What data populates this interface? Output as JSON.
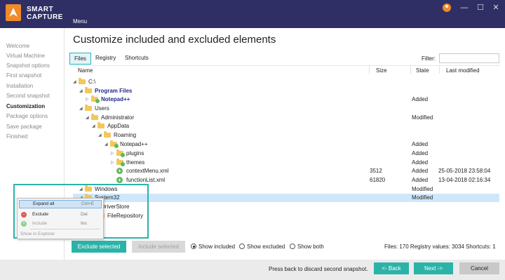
{
  "app": {
    "logo_line1": "SMART",
    "logo_line2": "CAPTURE",
    "menu": "Menu"
  },
  "window_controls": [
    "⚙",
    "—",
    "☐",
    "✕"
  ],
  "sidebar": {
    "items": [
      {
        "label": "Welcome",
        "active": false
      },
      {
        "label": "Virtual Machine",
        "active": false
      },
      {
        "label": "Snapshot options",
        "active": false
      },
      {
        "label": "First snapshot",
        "active": false
      },
      {
        "label": "Installation",
        "active": false
      },
      {
        "label": "Second snapshot",
        "active": false
      },
      {
        "label": "Customization",
        "active": true
      },
      {
        "label": "Package options",
        "active": false
      },
      {
        "label": "Save package",
        "active": false
      },
      {
        "label": "Finished",
        "active": false
      }
    ]
  },
  "main": {
    "title": "Customize included and excluded elements",
    "tabs": [
      {
        "label": "Files",
        "active": true
      },
      {
        "label": "Registry",
        "active": false
      },
      {
        "label": "Shortcuts",
        "active": false
      }
    ],
    "filter_label": "Filter:",
    "filter_value": "",
    "columns": {
      "name": "Name",
      "size": "Size",
      "state": "State",
      "modified": "Last modified"
    }
  },
  "tree": [
    {
      "name": "C:\\",
      "size": "",
      "state": "",
      "modified": "",
      "arrow": "◢",
      "icon": "folder",
      "highlight": false,
      "selected": false
    },
    {
      "name": "Program Files",
      "size": "",
      "state": "",
      "modified": "",
      "arrow": "◢",
      "icon": "folder",
      "highlight": true,
      "selected": false
    },
    {
      "name": "Notepad++",
      "size": "",
      "state": "Added",
      "modified": "",
      "arrow": "▷",
      "icon": "folder-plus",
      "highlight": true,
      "selected": false
    },
    {
      "name": "Users",
      "size": "",
      "state": "",
      "modified": "",
      "arrow": "◢",
      "icon": "folder",
      "highlight": false,
      "selected": false
    },
    {
      "name": "Administrator",
      "size": "",
      "state": "Modified",
      "modified": "",
      "arrow": "◢",
      "icon": "folder",
      "highlight": false,
      "selected": false
    },
    {
      "name": "AppData",
      "size": "",
      "state": "",
      "modified": "",
      "arrow": "◢",
      "icon": "folder",
      "highlight": false,
      "selected": false
    },
    {
      "name": "Roaming",
      "size": "",
      "state": "",
      "modified": "",
      "arrow": "◢",
      "icon": "folder",
      "highlight": false,
      "selected": false
    },
    {
      "name": "Notepad++",
      "size": "",
      "state": "Added",
      "modified": "",
      "arrow": "◢",
      "icon": "folder-plus",
      "highlight": false,
      "selected": false
    },
    {
      "name": "plugins",
      "size": "",
      "state": "Added",
      "modified": "",
      "arrow": "▷",
      "icon": "folder-plus",
      "highlight": false,
      "selected": false
    },
    {
      "name": "themes",
      "size": "",
      "state": "Added",
      "modified": "",
      "arrow": "▷",
      "icon": "folder-plus",
      "highlight": false,
      "selected": false
    },
    {
      "name": "contextMenu.xml",
      "size": "3512",
      "state": "Added",
      "modified": "25-05-2018 23:58:04",
      "arrow": "",
      "icon": "file-plus",
      "highlight": false,
      "selected": false
    },
    {
      "name": "functionList.xml",
      "size": "61820",
      "state": "Added",
      "modified": "13-04-2018 02:16:34",
      "arrow": "",
      "icon": "file-plus",
      "highlight": false,
      "selected": false
    },
    {
      "name": "Windows",
      "size": "",
      "state": "Modified",
      "modified": "",
      "arrow": "◢",
      "icon": "folder",
      "highlight": false,
      "selected": false
    },
    {
      "name": "System32",
      "size": "",
      "state": "Modified",
      "modified": "",
      "arrow": "◢",
      "icon": "folder",
      "highlight": false,
      "selected": true
    },
    {
      "name": "DriverStore",
      "size": "",
      "state": "",
      "modified": "",
      "arrow": "",
      "icon": "none",
      "highlight": false,
      "selected": false
    },
    {
      "name": "FileRepository",
      "size": "",
      "state": "",
      "modified": "",
      "arrow": "",
      "icon": "folder",
      "highlight": false,
      "selected": false
    }
  ],
  "context_menu": {
    "items": [
      {
        "label": "Expand all",
        "shortcut": "Ctrl+E",
        "icon": "",
        "disabled": false,
        "highlighted": true
      },
      {
        "label": "Exclude",
        "shortcut": "Del",
        "icon": "minus",
        "disabled": false,
        "highlighted": false
      },
      {
        "label": "Include",
        "shortcut": "Ins",
        "icon": "plus",
        "disabled": true,
        "highlighted": false
      },
      {
        "label": "Show in Explorer",
        "shortcut": "",
        "icon": "",
        "disabled": true,
        "highlighted": false
      }
    ]
  },
  "actions": {
    "exclude_selected": "Exclude selected",
    "include_selected": "Include selected",
    "radios": [
      {
        "label": "Show included",
        "checked": true
      },
      {
        "label": "Show excluded",
        "checked": false
      },
      {
        "label": "Show both",
        "checked": false
      }
    ],
    "stats": "Files: 170   Registry values: 3034   Shortcuts: 1"
  },
  "footer": {
    "note": "Press back to discard second snapshot.",
    "back": "<- Back",
    "next": "Next ->",
    "cancel": "Cancel"
  },
  "colors": {
    "header": "#2f2f66",
    "accent": "#2bb3a8",
    "brand": "#f08a2b"
  }
}
